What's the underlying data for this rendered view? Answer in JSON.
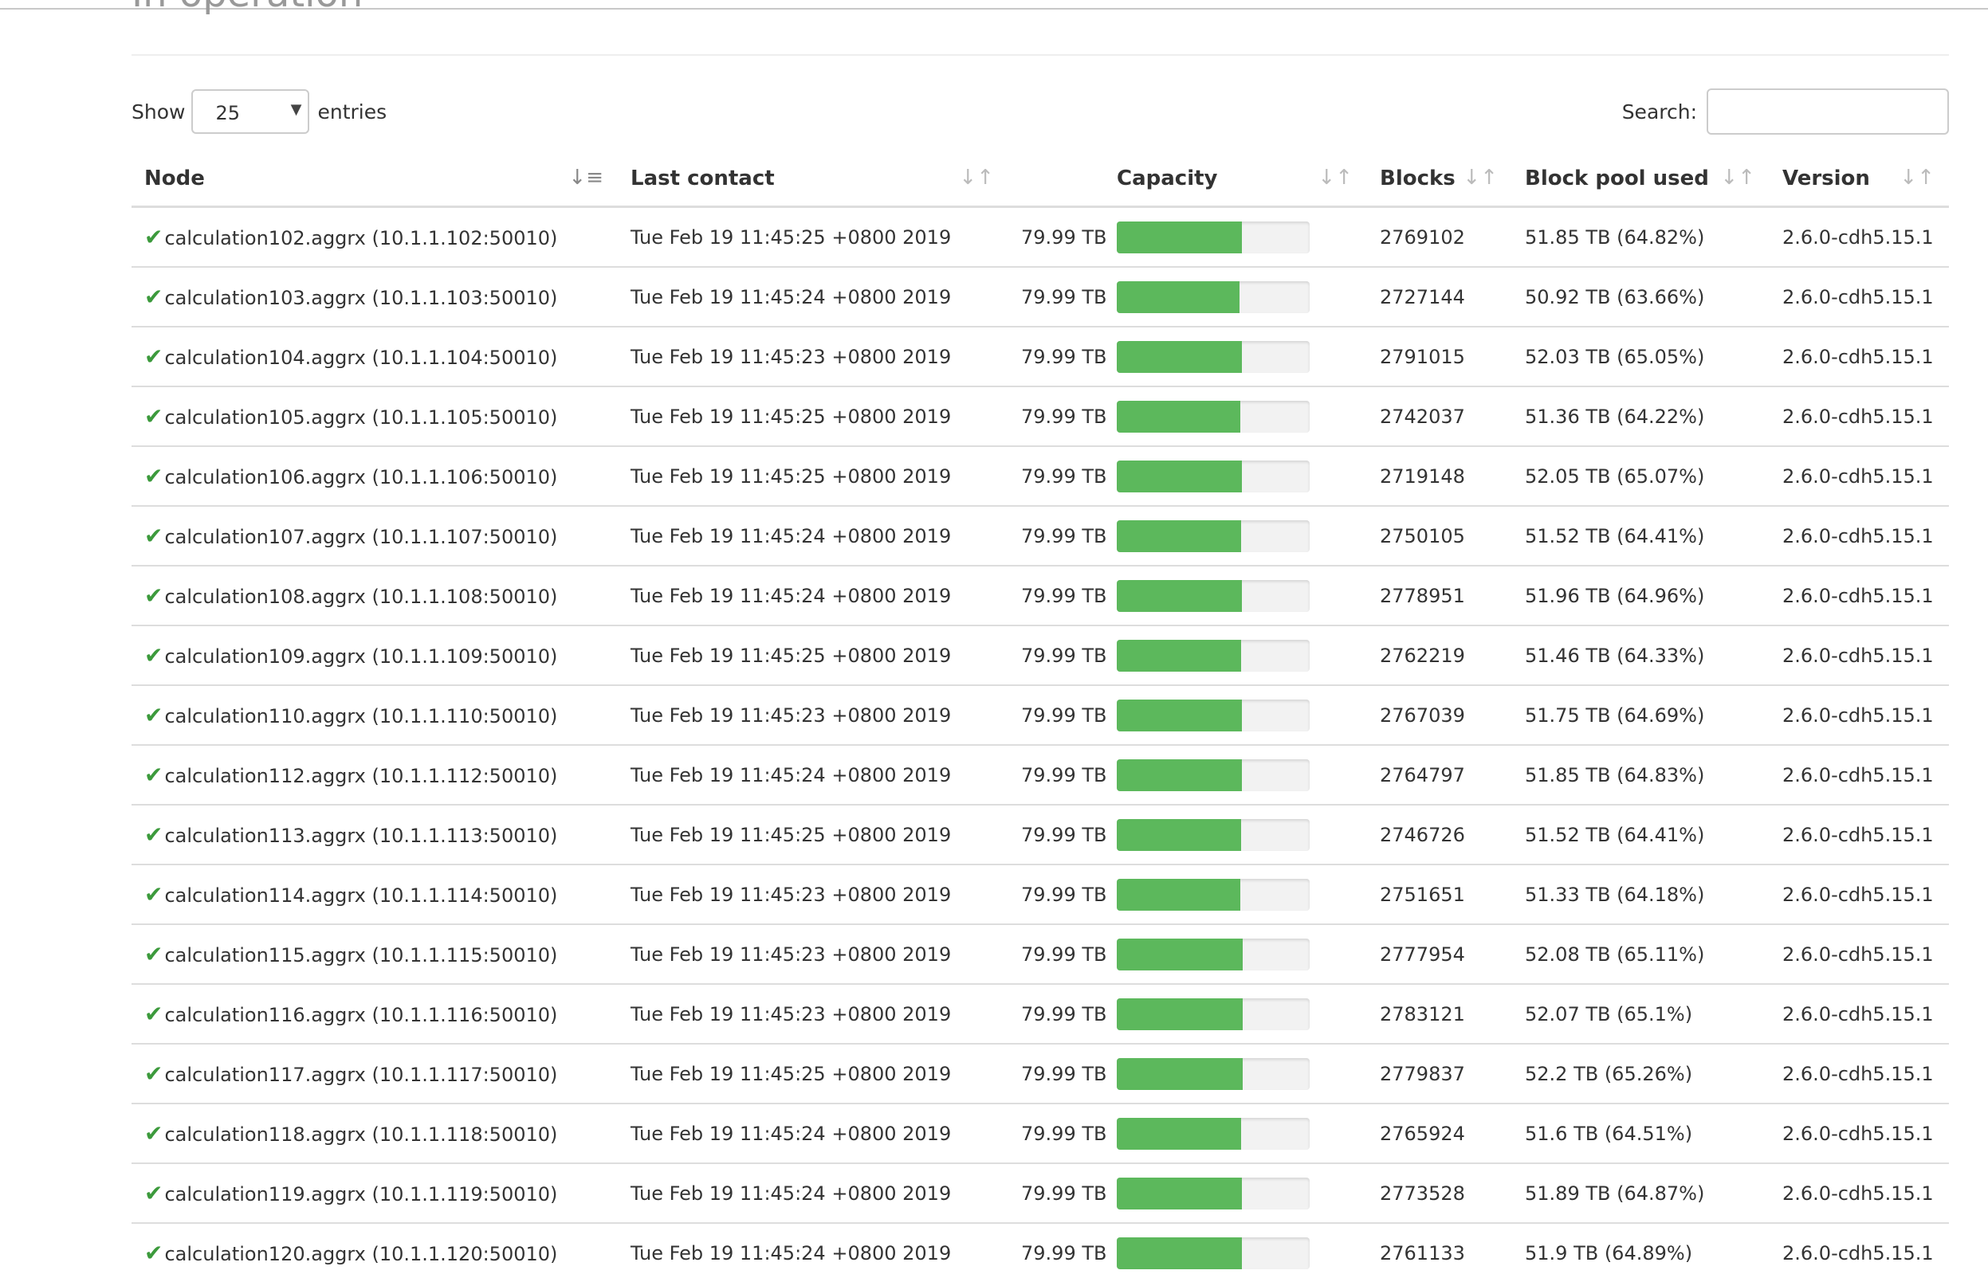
{
  "section": {
    "title": "In operation"
  },
  "controls": {
    "show_label": "Show",
    "length_value": "25",
    "entries_label": "entries",
    "search_label": "Search:",
    "search_value": ""
  },
  "table": {
    "columns": [
      {
        "key": "node",
        "label": "Node",
        "sort_icon": "sort-desc-icon"
      },
      {
        "key": "last_contact",
        "label": "Last contact",
        "sort_icon": "sort-icon"
      },
      {
        "key": "capacity",
        "label": "Capacity",
        "sort_icon": "sort-icon"
      },
      {
        "key": "blocks",
        "label": "Blocks",
        "sort_icon": "sort-icon"
      },
      {
        "key": "block_pool_used",
        "label": "Block pool used",
        "sort_icon": "sort-icon"
      },
      {
        "key": "version",
        "label": "Version",
        "sort_icon": "sort-icon"
      }
    ],
    "status_icon": "check-icon",
    "rows": [
      {
        "node": "calculation102.aggrx (10.1.1.102:50010)",
        "last_contact": "Tue Feb 19 11:45:25 +0800 2019",
        "capacity": "79.99 TB",
        "used_fraction": 0.6482,
        "blocks": "2769102",
        "block_pool_used": "51.85 TB (64.82%)",
        "version": "2.6.0-cdh5.15.1"
      },
      {
        "node": "calculation103.aggrx (10.1.1.103:50010)",
        "last_contact": "Tue Feb 19 11:45:24 +0800 2019",
        "capacity": "79.99 TB",
        "used_fraction": 0.6366,
        "blocks": "2727144",
        "block_pool_used": "50.92 TB (63.66%)",
        "version": "2.6.0-cdh5.15.1"
      },
      {
        "node": "calculation104.aggrx (10.1.1.104:50010)",
        "last_contact": "Tue Feb 19 11:45:23 +0800 2019",
        "capacity": "79.99 TB",
        "used_fraction": 0.6505,
        "blocks": "2791015",
        "block_pool_used": "52.03 TB (65.05%)",
        "version": "2.6.0-cdh5.15.1"
      },
      {
        "node": "calculation105.aggrx (10.1.1.105:50010)",
        "last_contact": "Tue Feb 19 11:45:25 +0800 2019",
        "capacity": "79.99 TB",
        "used_fraction": 0.6422,
        "blocks": "2742037",
        "block_pool_used": "51.36 TB (64.22%)",
        "version": "2.6.0-cdh5.15.1"
      },
      {
        "node": "calculation106.aggrx (10.1.1.106:50010)",
        "last_contact": "Tue Feb 19 11:45:25 +0800 2019",
        "capacity": "79.99 TB",
        "used_fraction": 0.6507,
        "blocks": "2719148",
        "block_pool_used": "52.05 TB (65.07%)",
        "version": "2.6.0-cdh5.15.1"
      },
      {
        "node": "calculation107.aggrx (10.1.1.107:50010)",
        "last_contact": "Tue Feb 19 11:45:24 +0800 2019",
        "capacity": "79.99 TB",
        "used_fraction": 0.6441,
        "blocks": "2750105",
        "block_pool_used": "51.52 TB (64.41%)",
        "version": "2.6.0-cdh5.15.1"
      },
      {
        "node": "calculation108.aggrx (10.1.1.108:50010)",
        "last_contact": "Tue Feb 19 11:45:24 +0800 2019",
        "capacity": "79.99 TB",
        "used_fraction": 0.6496,
        "blocks": "2778951",
        "block_pool_used": "51.96 TB (64.96%)",
        "version": "2.6.0-cdh5.15.1"
      },
      {
        "node": "calculation109.aggrx (10.1.1.109:50010)",
        "last_contact": "Tue Feb 19 11:45:25 +0800 2019",
        "capacity": "79.99 TB",
        "used_fraction": 0.6433,
        "blocks": "2762219",
        "block_pool_used": "51.46 TB (64.33%)",
        "version": "2.6.0-cdh5.15.1"
      },
      {
        "node": "calculation110.aggrx (10.1.1.110:50010)",
        "last_contact": "Tue Feb 19 11:45:23 +0800 2019",
        "capacity": "79.99 TB",
        "used_fraction": 0.6469,
        "blocks": "2767039",
        "block_pool_used": "51.75 TB (64.69%)",
        "version": "2.6.0-cdh5.15.1"
      },
      {
        "node": "calculation112.aggrx (10.1.1.112:50010)",
        "last_contact": "Tue Feb 19 11:45:24 +0800 2019",
        "capacity": "79.99 TB",
        "used_fraction": 0.6483,
        "blocks": "2764797",
        "block_pool_used": "51.85 TB (64.83%)",
        "version": "2.6.0-cdh5.15.1"
      },
      {
        "node": "calculation113.aggrx (10.1.1.113:50010)",
        "last_contact": "Tue Feb 19 11:45:25 +0800 2019",
        "capacity": "79.99 TB",
        "used_fraction": 0.6441,
        "blocks": "2746726",
        "block_pool_used": "51.52 TB (64.41%)",
        "version": "2.6.0-cdh5.15.1"
      },
      {
        "node": "calculation114.aggrx (10.1.1.114:50010)",
        "last_contact": "Tue Feb 19 11:45:23 +0800 2019",
        "capacity": "79.99 TB",
        "used_fraction": 0.6418,
        "blocks": "2751651",
        "block_pool_used": "51.33 TB (64.18%)",
        "version": "2.6.0-cdh5.15.1"
      },
      {
        "node": "calculation115.aggrx (10.1.1.115:50010)",
        "last_contact": "Tue Feb 19 11:45:23 +0800 2019",
        "capacity": "79.99 TB",
        "used_fraction": 0.6511,
        "blocks": "2777954",
        "block_pool_used": "52.08 TB (65.11%)",
        "version": "2.6.0-cdh5.15.1"
      },
      {
        "node": "calculation116.aggrx (10.1.1.116:50010)",
        "last_contact": "Tue Feb 19 11:45:23 +0800 2019",
        "capacity": "79.99 TB",
        "used_fraction": 0.651,
        "blocks": "2783121",
        "block_pool_used": "52.07 TB (65.1%)",
        "version": "2.6.0-cdh5.15.1"
      },
      {
        "node": "calculation117.aggrx (10.1.1.117:50010)",
        "last_contact": "Tue Feb 19 11:45:25 +0800 2019",
        "capacity": "79.99 TB",
        "used_fraction": 0.6526,
        "blocks": "2779837",
        "block_pool_used": "52.2 TB (65.26%)",
        "version": "2.6.0-cdh5.15.1"
      },
      {
        "node": "calculation118.aggrx (10.1.1.118:50010)",
        "last_contact": "Tue Feb 19 11:45:24 +0800 2019",
        "capacity": "79.99 TB",
        "used_fraction": 0.6451,
        "blocks": "2765924",
        "block_pool_used": "51.6 TB (64.51%)",
        "version": "2.6.0-cdh5.15.1"
      },
      {
        "node": "calculation119.aggrx (10.1.1.119:50010)",
        "last_contact": "Tue Feb 19 11:45:24 +0800 2019",
        "capacity": "79.99 TB",
        "used_fraction": 0.6487,
        "blocks": "2773528",
        "block_pool_used": "51.89 TB (64.87%)",
        "version": "2.6.0-cdh5.15.1"
      },
      {
        "node": "calculation120.aggrx (10.1.1.120:50010)",
        "last_contact": "Tue Feb 19 11:45:24 +0800 2019",
        "capacity": "79.99 TB",
        "used_fraction": 0.6489,
        "blocks": "2761133",
        "block_pool_used": "51.9 TB (64.89%)",
        "version": "2.6.0-cdh5.15.1"
      }
    ]
  },
  "colors": {
    "bar_fill": "#5cb85c",
    "bar_track": "#f2f2f2",
    "check": "#3c9a3c",
    "border": "#dddddd"
  }
}
